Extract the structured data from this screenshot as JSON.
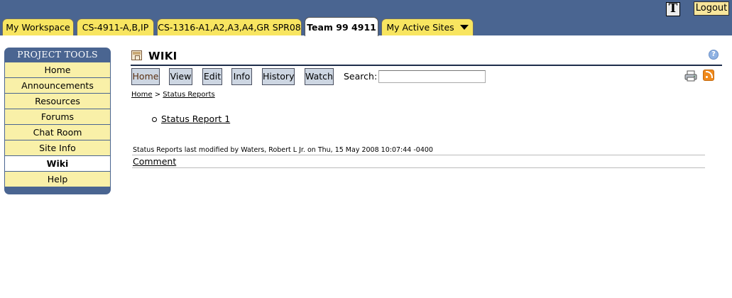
{
  "banner": {
    "text_tool_glyph": "T",
    "logout_label": "Logout",
    "bg_color": "#4a6591"
  },
  "tabs": [
    {
      "label": "My Workspace",
      "active": false
    },
    {
      "label": "CS-4911-A,B,IP",
      "active": false
    },
    {
      "label": "CS-1316-A1,A2,A3,A4,GR SPR08",
      "active": false
    },
    {
      "label": "Team 99 4911",
      "active": true
    },
    {
      "label": "My Active Sites",
      "active": false,
      "dropdown": true
    }
  ],
  "sidebar": {
    "title": "PROJECT TOOLS",
    "items": [
      {
        "label": "Home"
      },
      {
        "label": "Announcements"
      },
      {
        "label": "Resources"
      },
      {
        "label": "Forums"
      },
      {
        "label": "Chat Room"
      },
      {
        "label": "Site Info"
      },
      {
        "label": "Wiki",
        "current": true
      },
      {
        "label": "Help"
      }
    ]
  },
  "main": {
    "title": "WIKI",
    "help_glyph": "?",
    "toolbar": {
      "home": "Home",
      "view": "View",
      "edit": "Edit",
      "info": "Info",
      "history": "History",
      "watch": "Watch",
      "search_label": "Search:",
      "search_value": ""
    },
    "breadcrumb": {
      "home": "Home",
      "separator": ">",
      "current": "Status Reports"
    },
    "reports": [
      {
        "label": "Status Report 1"
      }
    ],
    "modified_text": "Status Reports last modified by Waters, Robert L Jr. on Thu, 15 May 2008 10:07:44 -0400",
    "comment_label": "Comment"
  },
  "colors": {
    "tab_yellow": "#f8e560",
    "sidebar_item": "#f9f0a8",
    "toolbar_button": "#cdd6e2",
    "rss_orange": "#f08a1c"
  }
}
